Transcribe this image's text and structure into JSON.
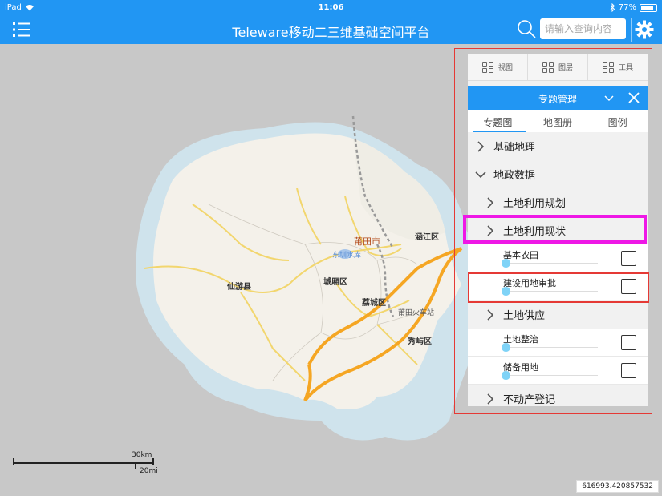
{
  "status_bar": {
    "device": "iPad",
    "time": "11:06",
    "battery": "77%",
    "battery_level": 0.77
  },
  "nav": {
    "title": "Teleware移动二三维基础空间平台",
    "search_placeholder": "请输入查询内容",
    "icons": {
      "menu": "list-icon",
      "search": "search-icon",
      "settings": "gear-icon"
    }
  },
  "map": {
    "labels": {
      "city": "莆田市",
      "hanjiang": "涵江区",
      "xianyou": "仙游县",
      "chengxiang": "城厢区",
      "licheng": "荔城区",
      "xiuyu": "秀屿区",
      "station": "莆田火车站",
      "lake": "东圳水库"
    },
    "scale": {
      "km": "30km",
      "mi": "20mi"
    },
    "coordinates": "616993.420857532"
  },
  "panel": {
    "toolbar": [
      {
        "label": "视图",
        "icon": "grid-icon"
      },
      {
        "label": "图层",
        "icon": "grid-icon"
      },
      {
        "label": "工具",
        "icon": "grid-icon"
      }
    ],
    "header_title": "专题管理",
    "tabs": [
      {
        "label": "专题图",
        "active": true
      },
      {
        "label": "地图册",
        "active": false
      },
      {
        "label": "图例",
        "active": false
      }
    ],
    "tree": {
      "basic_geo": "基础地理",
      "land_admin": "地政数据",
      "land_plan": "土地利用规划",
      "land_status": "土地利用现状",
      "layer_basic_farmland": "基本农田",
      "layer_construction_approval": "建设用地审批",
      "land_supply": "土地供应",
      "layer_land_consolidation": "土地整治",
      "layer_reserve_land": "储备用地",
      "real_estate": "不动产登记"
    }
  },
  "colors": {
    "brand": "#2196f3",
    "highlight_magenta": "#ee18e6",
    "highlight_red": "#e53935",
    "slider_knob": "#7fd3f7"
  }
}
